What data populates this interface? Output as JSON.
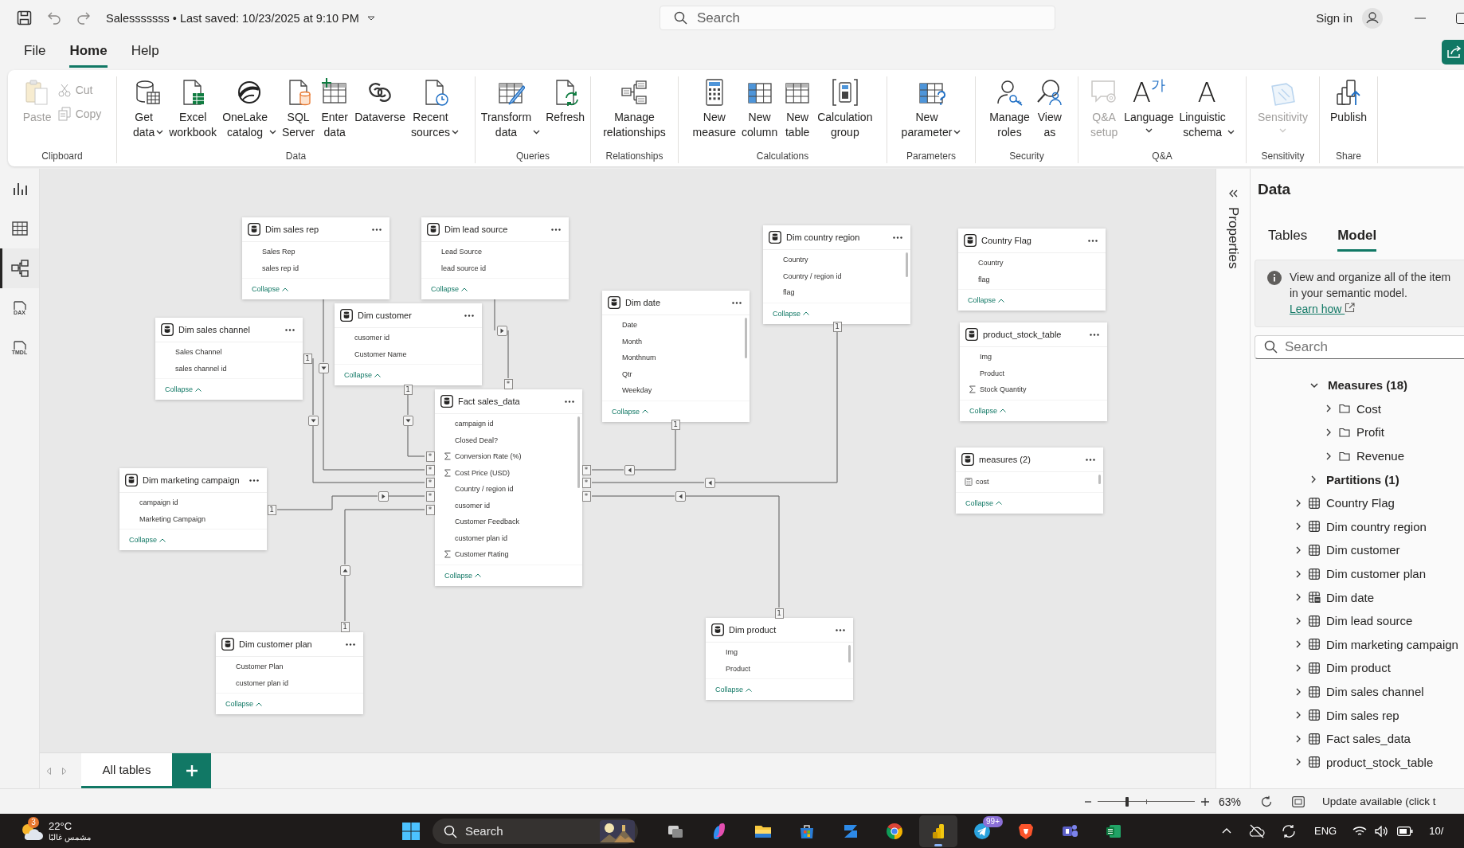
{
  "title_bar": {
    "title": "Salesssssss • Last saved: 10/23/2025 at 9:10 PM",
    "search": {
      "placeholder": "Search"
    },
    "sign_in": "Sign in"
  },
  "menu_tabs": [
    {
      "label": "File",
      "selected": false
    },
    {
      "label": "Home",
      "selected": true
    },
    {
      "label": "Help",
      "selected": false
    }
  ],
  "ribbon": {
    "groups": [
      {
        "label": "Clipboard",
        "buttons": [
          {
            "label": "Paste",
            "kind": "large",
            "disabled": true,
            "dropdown": false
          },
          {
            "label": "Cut",
            "kind": "small",
            "disabled": true,
            "dropdown": false
          },
          {
            "label": "Copy",
            "kind": "small",
            "disabled": true,
            "dropdown": false
          }
        ]
      },
      {
        "label": "Data",
        "buttons": [
          {
            "label": "Get data",
            "kind": "large",
            "disabled": false,
            "dropdown": true
          },
          {
            "label": "Excel workbook",
            "kind": "large",
            "disabled": false,
            "dropdown": false
          },
          {
            "label": "OneLake catalog",
            "kind": "large",
            "disabled": false,
            "dropdown": true
          },
          {
            "label": "SQL Server",
            "kind": "large",
            "disabled": false,
            "dropdown": false
          },
          {
            "label": "Enter data",
            "kind": "large",
            "disabled": false,
            "dropdown": false
          },
          {
            "label": "Dataverse",
            "kind": "large",
            "disabled": false,
            "dropdown": false
          },
          {
            "label": "Recent sources",
            "kind": "large",
            "disabled": false,
            "dropdown": true
          }
        ]
      },
      {
        "label": "Queries",
        "buttons": [
          {
            "label": "Transform data",
            "kind": "large",
            "disabled": false,
            "dropdown": true
          },
          {
            "label": "Refresh",
            "kind": "large",
            "disabled": false,
            "dropdown": false
          }
        ]
      },
      {
        "label": "Relationships",
        "buttons": [
          {
            "label": "Manage relationships",
            "kind": "large",
            "disabled": false,
            "dropdown": false
          }
        ]
      },
      {
        "label": "Calculations",
        "buttons": [
          {
            "label": "New measure",
            "kind": "large",
            "disabled": false,
            "dropdown": false
          },
          {
            "label": "New column",
            "kind": "large",
            "disabled": false,
            "dropdown": false
          },
          {
            "label": "New table",
            "kind": "large",
            "disabled": false,
            "dropdown": false
          },
          {
            "label": "Calculation group",
            "kind": "large",
            "disabled": false,
            "dropdown": false
          }
        ]
      },
      {
        "label": "Parameters",
        "buttons": [
          {
            "label": "New parameter",
            "kind": "large",
            "disabled": false,
            "dropdown": true
          }
        ]
      },
      {
        "label": "Security",
        "buttons": [
          {
            "label": "Manage roles",
            "kind": "large",
            "disabled": false,
            "dropdown": false
          },
          {
            "label": "View as",
            "kind": "large",
            "disabled": false,
            "dropdown": false
          }
        ]
      },
      {
        "label": "Q&A",
        "buttons": [
          {
            "label": "Q&A setup",
            "kind": "large",
            "disabled": true,
            "dropdown": false
          },
          {
            "label": "Language",
            "kind": "large",
            "disabled": false,
            "dropdown": true,
            "icon_text": "A$^{가}$"
          },
          {
            "label": "Linguistic schema",
            "kind": "large",
            "disabled": false,
            "dropdown": true,
            "icon_text": "A"
          }
        ]
      },
      {
        "label": "Sensitivity",
        "buttons": [
          {
            "label": "Sensitivity",
            "kind": "large",
            "disabled": true,
            "dropdown": true
          }
        ]
      },
      {
        "label": "Share",
        "buttons": [
          {
            "label": "Publish",
            "kind": "large",
            "disabled": false,
            "dropdown": false
          }
        ]
      }
    ]
  },
  "nav_rail": [
    {
      "selected": false
    },
    {
      "selected": false
    },
    {
      "selected": true
    },
    {
      "label": "DAX",
      "selected": false
    },
    {
      "label": "TMDL",
      "selected": false
    }
  ],
  "canvas": {
    "tables": [
      {
        "name": "Dim sales rep",
        "fields": [
          {
            "name": "Sales Rep",
            "kind": "column"
          },
          {
            "name": "sales rep id",
            "kind": "column"
          }
        ],
        "scrollbar": false,
        "collapse": "Collapse"
      },
      {
        "name": "Dim lead source",
        "fields": [
          {
            "name": "Lead Source",
            "kind": "column"
          },
          {
            "name": "lead source id",
            "kind": "column"
          }
        ],
        "scrollbar": false,
        "collapse": "Collapse"
      },
      {
        "name": "Dim country region",
        "fields": [
          {
            "name": "Country",
            "kind": "column"
          },
          {
            "name": "Country / region id",
            "kind": "column"
          },
          {
            "name": "flag",
            "kind": "column"
          }
        ],
        "scrollbar": true,
        "collapse": "Collapse"
      },
      {
        "name": "Country Flag",
        "fields": [
          {
            "name": "Country",
            "kind": "column"
          },
          {
            "name": "flag",
            "kind": "column"
          }
        ],
        "scrollbar": false,
        "collapse": "Collapse"
      },
      {
        "name": "Dim customer",
        "fields": [
          {
            "name": "cusomer id",
            "kind": "column"
          },
          {
            "name": "Customer Name",
            "kind": "column"
          }
        ],
        "scrollbar": false,
        "collapse": "Collapse"
      },
      {
        "name": "Dim date",
        "fields": [
          {
            "name": "Date",
            "kind": "column"
          },
          {
            "name": "Month",
            "kind": "column"
          },
          {
            "name": "Monthnum",
            "kind": "column"
          },
          {
            "name": "Qtr",
            "kind": "column"
          },
          {
            "name": "Weekday",
            "kind": "column"
          }
        ],
        "scrollbar": true,
        "collapse": "Collapse"
      },
      {
        "name": "product_stock_table",
        "fields": [
          {
            "name": "Img",
            "kind": "column"
          },
          {
            "name": "Product",
            "kind": "column"
          },
          {
            "name": "Stock Quantity",
            "kind": "summed"
          }
        ],
        "scrollbar": false,
        "collapse": "Collapse"
      },
      {
        "name": "Dim sales channel",
        "fields": [
          {
            "name": "Sales Channel",
            "kind": "column"
          },
          {
            "name": "sales channel id",
            "kind": "column"
          }
        ],
        "scrollbar": false,
        "collapse": "Collapse"
      },
      {
        "name": "Fact sales_data",
        "fields": [
          {
            "name": "campaign id",
            "kind": "column"
          },
          {
            "name": "Closed Deal?",
            "kind": "column"
          },
          {
            "name": "Conversion Rate (%)",
            "kind": "summed"
          },
          {
            "name": "Cost Price (USD)",
            "kind": "summed"
          },
          {
            "name": "Country / region id",
            "kind": "column"
          },
          {
            "name": "cusomer id",
            "kind": "column"
          },
          {
            "name": "Customer Feedback",
            "kind": "column"
          },
          {
            "name": "customer plan id",
            "kind": "column"
          },
          {
            "name": "Customer Rating",
            "kind": "summed"
          }
        ],
        "scrollbar": true,
        "collapse": "Collapse"
      },
      {
        "name": "measures (2)",
        "fields": [
          {
            "name": "cost",
            "kind": "measure"
          }
        ],
        "scrollbar": true,
        "collapse": "Collapse"
      },
      {
        "name": "Dim marketing campaign",
        "fields": [
          {
            "name": "campaign id",
            "kind": "column"
          },
          {
            "name": "Marketing Campaign",
            "kind": "column"
          }
        ],
        "scrollbar": false,
        "collapse": "Collapse"
      },
      {
        "name": "Dim product",
        "fields": [
          {
            "name": "Img",
            "kind": "column"
          },
          {
            "name": "Product",
            "kind": "column"
          }
        ],
        "scrollbar": true,
        "collapse": "Collapse"
      },
      {
        "name": "Dim customer plan",
        "fields": [
          {
            "name": "Customer Plan",
            "kind": "column"
          },
          {
            "name": "customer plan id",
            "kind": "column"
          }
        ],
        "scrollbar": false,
        "collapse": "Collapse"
      }
    ],
    "relationships": [
      {
        "one_end": "1",
        "many_end": "*"
      },
      {
        "many_end": "*"
      },
      {
        "one_end": "1",
        "many_end": "*"
      },
      {
        "one_end": "1",
        "many_end": "*"
      },
      {
        "one_end": "1",
        "many_end": "*"
      },
      {
        "many_end": "*"
      },
      {
        "one_end": "1",
        "many_end": "*"
      },
      {
        "one_end": "1",
        "many_end": "*"
      },
      {
        "one_end": "1",
        "many_end": "*"
      }
    ],
    "page_tabs": [
      {
        "label": "All tables",
        "selected": true
      }
    ]
  },
  "properties_pane": {
    "title": "Properties"
  },
  "data_pane": {
    "title": "Data",
    "tabs": [
      {
        "label": "Tables",
        "selected": false
      },
      {
        "label": "Model",
        "selected": true
      }
    ],
    "info": {
      "text": "View and organize all of the item in your semantic model.",
      "link": "Learn how"
    },
    "search": {
      "placeholder": "Search"
    },
    "model_tree": [
      {
        "children": [
          {
            "label": "Measures (18)",
            "kind": "category",
            "expanded": true,
            "children": [
              {
                "label": "Cost",
                "kind": "folder",
                "expanded": false
              },
              {
                "label": "Profit",
                "kind": "folder",
                "expanded": false
              },
              {
                "label": "Revenue",
                "kind": "folder",
                "expanded": false
              }
            ]
          },
          {
            "label": "Partitions (1)",
            "kind": "category",
            "expanded": false
          }
        ]
      },
      {
        "label": "Country Flag",
        "kind": "table",
        "expanded": false
      },
      {
        "label": "Dim country region",
        "kind": "table",
        "expanded": false
      },
      {
        "label": "Dim customer",
        "kind": "table",
        "expanded": false
      },
      {
        "label": "Dim customer plan",
        "kind": "table",
        "expanded": false
      },
      {
        "label": "Dim date",
        "kind": "date_table",
        "expanded": false
      },
      {
        "label": "Dim lead source",
        "kind": "table",
        "expanded": false
      },
      {
        "label": "Dim marketing campaign",
        "kind": "table",
        "expanded": false
      },
      {
        "label": "Dim product",
        "kind": "table",
        "expanded": false
      },
      {
        "label": "Dim sales channel",
        "kind": "table",
        "expanded": false
      },
      {
        "label": "Dim sales rep",
        "kind": "table",
        "expanded": false
      },
      {
        "label": "Fact sales_data",
        "kind": "table",
        "expanded": false
      },
      {
        "label": "product_stock_table",
        "kind": "table",
        "expanded": false
      }
    ]
  },
  "status_bar": {
    "zoom_slider": {
      "level": 0.3
    },
    "zoom": "63%",
    "update": "Update available (click t"
  },
  "taskbar": {
    "weather": {
      "badge": "3",
      "temperature": "22°C",
      "condition": "مشمس غالبًا"
    },
    "search": {
      "placeholder": "Search"
    },
    "apps": [
      {
        "selected": false
      },
      {
        "selected": false
      },
      {
        "selected": false
      },
      {
        "selected": false
      },
      {
        "selected": false
      },
      {
        "selected": false
      },
      {
        "selected": true
      },
      {
        "selected": false,
        "badge": "99+"
      },
      {
        "selected": false
      },
      {
        "selected": false
      },
      {
        "selected": false
      }
    ],
    "tray": {
      "language": "ENG",
      "clock": "10/"
    }
  }
}
